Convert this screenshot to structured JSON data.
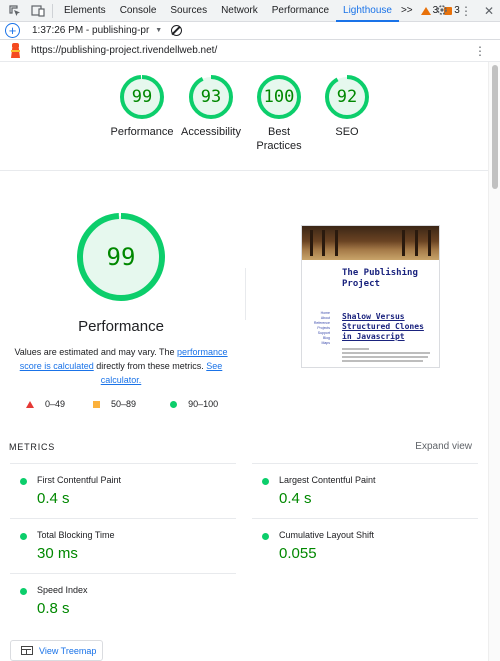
{
  "devtools": {
    "tabs": [
      "Elements",
      "Console",
      "Sources",
      "Network",
      "Performance",
      "Lighthouse"
    ],
    "active_tab": "Lighthouse",
    "overflow_label": ">>",
    "warnings_count": "3",
    "issues_count": "3"
  },
  "toolbar": {
    "session_label": "1:37:26 PM - publishing-pr"
  },
  "urlbar": {
    "url": "https://publishing-project.rivendellweb.net/"
  },
  "scores": [
    {
      "score": 99,
      "label": "Performance"
    },
    {
      "score": 93,
      "label": "Accessibility"
    },
    {
      "score": 100,
      "label": "Best Practices"
    },
    {
      "score": 92,
      "label": "SEO"
    }
  ],
  "performance": {
    "score": 99,
    "title": "Performance",
    "desc_prefix": "Values are estimated and may vary. The ",
    "desc_link1": "performance score is calculated",
    "desc_mid": " directly from these metrics. ",
    "desc_link2": "See calculator.",
    "legend": [
      {
        "shape": "triangle",
        "color": "#e53935",
        "range": "0–49"
      },
      {
        "shape": "square",
        "color": "#fbb13c",
        "range": "50–89"
      },
      {
        "shape": "circle",
        "color": "#0cce6b",
        "range": "90–100"
      }
    ]
  },
  "screenshot": {
    "site_title": "The Publishing Project",
    "post_title": "Shalow Versus Structured Clones in Javascript",
    "nav": [
      "Home",
      "About",
      "Reference",
      "Projects",
      "Support",
      "Blog",
      "Maps"
    ]
  },
  "metrics": {
    "label": "METRICS",
    "expand_label": "Expand view",
    "items": [
      {
        "name": "First Contentful Paint",
        "value": "0.4 s"
      },
      {
        "name": "Largest Contentful Paint",
        "value": "0.4 s"
      },
      {
        "name": "Total Blocking Time",
        "value": "30 ms"
      },
      {
        "name": "Cumulative Layout Shift",
        "value": "0.055"
      },
      {
        "name": "Speed Index",
        "value": "0.8 s"
      }
    ]
  },
  "treemap_label": "View Treemap",
  "colors": {
    "pass_green": "#0cce6b",
    "pass_text": "#008800",
    "link_blue": "#1a73e8"
  }
}
